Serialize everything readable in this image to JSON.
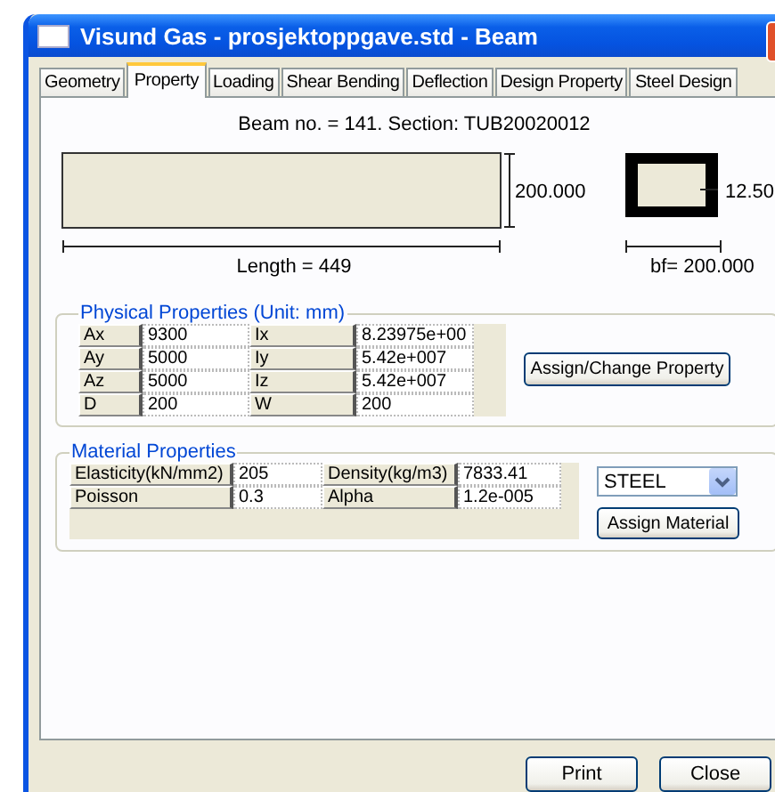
{
  "window": {
    "title": "Visund Gas - prosjektoppgave.std - Beam"
  },
  "tabs": [
    {
      "label": "Geometry",
      "selected": false
    },
    {
      "label": "Property",
      "selected": true
    },
    {
      "label": "Loading",
      "selected": false
    },
    {
      "label": "Shear Bending",
      "selected": false
    },
    {
      "label": "Deflection",
      "selected": false
    },
    {
      "label": "Design Property",
      "selected": false
    },
    {
      "label": "Steel Design",
      "selected": false
    }
  ],
  "beam": {
    "caption": "Beam no. = 141. Section: TUB20020012",
    "depth_label": "200.000",
    "thickness_label": "12.50",
    "length_label": "Length = 449",
    "width_label": "bf= 200.000"
  },
  "physical_properties": {
    "title": "Physical Properties (Unit: mm)",
    "rows": [
      [
        {
          "label": "Ax",
          "value": "9300"
        },
        {
          "label": "Ix",
          "value": "8.23975e+00"
        }
      ],
      [
        {
          "label": "Ay",
          "value": "5000"
        },
        {
          "label": "Iy",
          "value": "5.42e+007"
        }
      ],
      [
        {
          "label": "Az",
          "value": "5000"
        },
        {
          "label": "Iz",
          "value": "5.42e+007"
        }
      ],
      [
        {
          "label": "D",
          "value": "200"
        },
        {
          "label": "W",
          "value": "200"
        }
      ]
    ],
    "button": "Assign/Change Property"
  },
  "material_properties": {
    "title": "Material Properties",
    "rows": [
      [
        {
          "label": "Elasticity(kN/mm2)",
          "value": "205"
        },
        {
          "label": "Density(kg/m3)",
          "value": "7833.41"
        }
      ],
      [
        {
          "label": "Poisson",
          "value": "0.3"
        },
        {
          "label": "Alpha",
          "value": "1.2e-005"
        }
      ]
    ],
    "material": {
      "value": "STEEL"
    },
    "button": "Assign Material"
  },
  "buttons": [
    "Print",
    "Close"
  ]
}
